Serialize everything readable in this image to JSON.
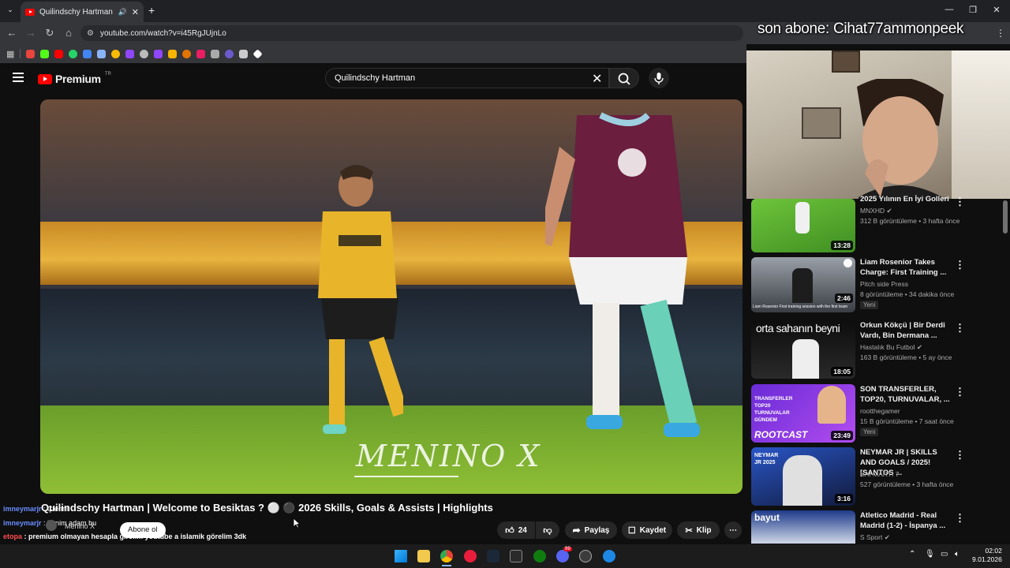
{
  "browser": {
    "tab_title": "Quilindschy Hartman •Welɔ",
    "url": "youtube.com/watch?v=i45RgJUjnLo"
  },
  "youtube": {
    "logo_text": "Premium",
    "logo_region": "TR",
    "search_value": "Quilindschy Hartman"
  },
  "overlay": {
    "last_subscriber": "son abone: Cihat77ammonpeek"
  },
  "video": {
    "watermark": "MENINO X",
    "title": "Quilindschy Hartman | Welcome to Besiktas ? ⚪ ⚫ 2026 Skills, Goals & Assists | Highlights",
    "channel": "Menino X",
    "subscribe_label": "Abone ol",
    "like_count": "24",
    "share_label": "Paylaş",
    "save_label": "Kaydet",
    "clip_label": "Klip"
  },
  "chat": [
    {
      "user": "imneymarjr",
      "text": "Çtenni"
    },
    {
      "user": "imneymarjr",
      "text": "benim adam bu"
    },
    {
      "user": "etopa",
      "text": "premium olmayan hesapla girelim youtube a islamik görelim 3dk"
    }
  ],
  "recommendations": [
    {
      "title": "2025 Yılının En İyi Golleri",
      "channel": "MNXHD",
      "verified": true,
      "meta": "312 B görüntüleme • 3 hafta önce",
      "duration": "13:28",
      "badge": ""
    },
    {
      "title": "Liam Rosenior Takes Charge: First Training ...",
      "channel": "Pitch side Press",
      "verified": false,
      "meta": "8 görüntüleme • 34 dakika önce",
      "duration": "2:46",
      "badge": "Yeni",
      "caption": "Liam Rosenior First training session with the first team"
    },
    {
      "title": "Orkun Kökçü | Bir Derdi Vardı, Bin Dermana ...",
      "channel": "Hastalık Bu Futbol",
      "verified": true,
      "meta": "163 B görüntüleme • 5 ay önce",
      "duration": "18:05",
      "badge": "",
      "thumb_text": "orta sahanın beyni"
    },
    {
      "title": "SON TRANSFERLER, TOP20, TURNUVALAR, ...",
      "channel": "rootthegamer",
      "verified": false,
      "meta": "15 B görüntüleme • 7 saat önce",
      "duration": "23:49",
      "badge": "Yeni",
      "thumb_text": "ROOTCAST",
      "thumb_lines": "TRANSFERLER TOP20 TURNUVALAR GÜNDEM"
    },
    {
      "title": "NEYMAR JR | SKILLS AND GOALS / 2025! [SANTOS ...",
      "channel": "KAI MARTI 7",
      "verified": false,
      "meta": "527 görüntüleme • 3 hafta önce",
      "duration": "3:16",
      "badge": "",
      "thumb_text": "NEYMAR JR 2025"
    },
    {
      "title": "Atletico Madrid - Real Madrid (1-2) - İspanya ...",
      "channel": "S Sport",
      "verified": true,
      "meta": "",
      "duration": "",
      "badge": "",
      "thumb_text": "bayut"
    }
  ],
  "taskbar": {
    "time": "02:02",
    "date": "9.01.2026",
    "discord_badge": "99"
  },
  "colors": {
    "yt_red": "#ff0000",
    "bg": "#0f0f0f",
    "chip": "#272727"
  }
}
